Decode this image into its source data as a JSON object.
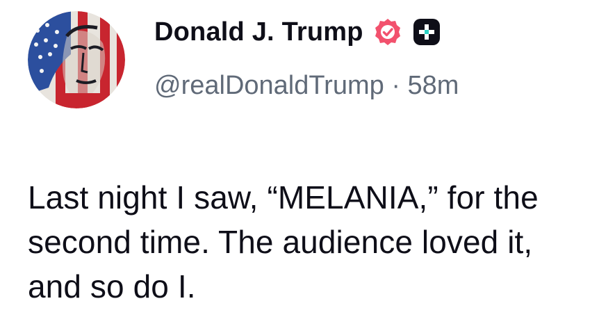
{
  "post": {
    "display_name": "Donald J. Trump",
    "handle": "@realDonaldTrump",
    "separator": "·",
    "time_ago": "58m",
    "text": "Last night I saw, “MELANIA,” for the second time. The audience loved it, and so do I."
  },
  "icons": {
    "avatar": "profile-avatar",
    "verified": "verified-badge-icon",
    "app_badge": "plus-badge-icon"
  },
  "colors": {
    "verified": "#f2516d",
    "handle": "#606a78",
    "text": "#0e0e18",
    "app_badge": "#0e0e18",
    "app_badge_accent": "#2bd4c6"
  }
}
